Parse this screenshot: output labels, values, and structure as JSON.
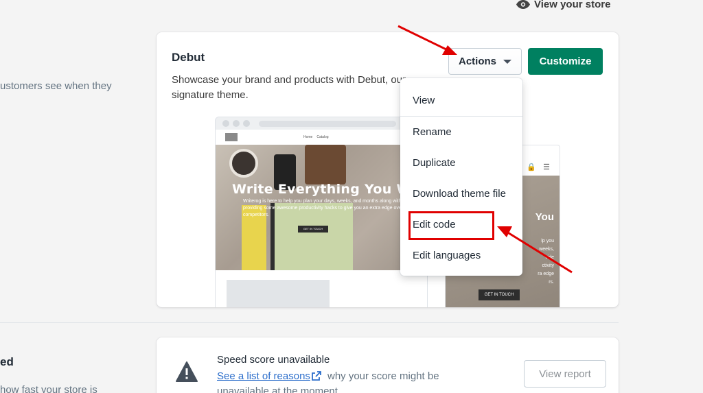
{
  "header": {
    "view_store_label": "View your store"
  },
  "left_section": {
    "theme_helper_text": "ustomers see when they",
    "speed_heading": "ed",
    "speed_helper_text": "how fast your store is"
  },
  "theme_card": {
    "theme_name": "Debut",
    "description": "Showcase your brand and products with Debut, our signature theme.",
    "actions_label": "Actions",
    "customize_label": "Customize",
    "preview": {
      "nav_links": [
        "Home",
        "Catalog"
      ],
      "hero_title": "Write Everything You W",
      "hero_text": "Writerog is here to help you plan your days, weeks, and months along with providing some awesome productivity hacks to give you an extra edge over your competitors.",
      "cta_label": "GET IN TOUCH",
      "mobile_hero_title": "You",
      "mobile_hero_lines": [
        "lp you",
        "weeks,",
        "vide",
        "ctivity",
        "ra edge",
        "rs."
      ],
      "mobile_cta_label": "GET IN TOUCH"
    }
  },
  "actions_menu": {
    "items": [
      {
        "label": "View"
      },
      {
        "label": "Rename"
      },
      {
        "label": "Duplicate"
      },
      {
        "label": "Download theme file"
      },
      {
        "label": "Edit code"
      },
      {
        "label": "Edit languages"
      }
    ]
  },
  "speed_card": {
    "title": "Speed score unavailable",
    "link_text": "See a list of reasons",
    "tail_text": "why your score might be",
    "line2": "unavailable at the moment.",
    "view_report_label": "View report"
  },
  "colors": {
    "primary_button": "#008060",
    "annotation_red": "#e00000",
    "link_blue": "#2c6ecb"
  }
}
